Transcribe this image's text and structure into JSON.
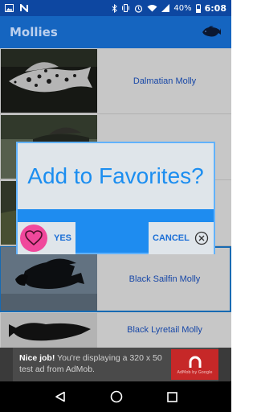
{
  "status_bar": {
    "battery": "40%",
    "time": "6:08",
    "left_icons": [
      "photo-icon",
      "n-notification-icon"
    ],
    "right_icons": [
      "bluetooth-icon",
      "vibrate-icon",
      "alarm-icon",
      "wifi-icon",
      "signal-icon",
      "battery-icon"
    ]
  },
  "app_bar": {
    "title": "Mollies",
    "action_icon": "fish-icon"
  },
  "list": {
    "items": [
      {
        "label": "Dalmatian Molly",
        "thumb": "dalmatian-molly-photo"
      },
      {
        "label": "",
        "thumb": "molly-photo"
      },
      {
        "label": "",
        "thumb": "molly-photo"
      },
      {
        "label": "Black Sailfin Molly",
        "thumb": "black-sailfin-molly-photo"
      },
      {
        "label": "Black Lyretail Molly",
        "thumb": "black-lyretail-molly-photo"
      }
    ]
  },
  "dialog": {
    "title": "Add to Favorites?",
    "yes_label": "YES",
    "cancel_label": "CANCEL",
    "yes_icon": "heart-icon",
    "cancel_icon": "close-circle-icon"
  },
  "ad": {
    "bold_text": "Nice job!",
    "text": " You're displaying a 320 x 50 test ad from AdMob.",
    "logo_caption": "AdMob by Google"
  },
  "nav_bar": {
    "icons": [
      "back-icon",
      "home-icon",
      "recents-icon"
    ]
  },
  "colors": {
    "status_bar": "#0d47a1",
    "app_bar": "#1565c0",
    "list_label": "#1e5bd6",
    "dialog_accent": "#1e8cf0",
    "dialog_panel": "#dfe5ea",
    "heart": "#f0489c",
    "ad_logo": "#c62828"
  }
}
